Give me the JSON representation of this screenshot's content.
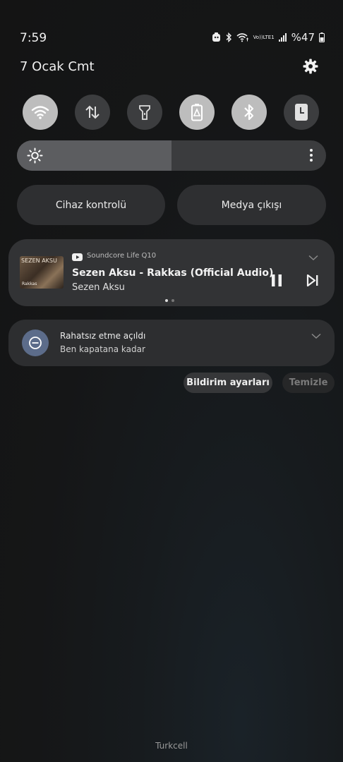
{
  "status_bar": {
    "time": "7:59",
    "volte_top": "Vo))",
    "volte_bottom": "LTE1",
    "battery": "%47"
  },
  "header": {
    "date": "7 Ocak Cmt",
    "settings_icon": "gear-icon"
  },
  "quick_toggles": [
    {
      "name": "wifi",
      "icon": "wifi-icon",
      "on": true
    },
    {
      "name": "mobile-data",
      "icon": "data-arrows-icon",
      "on": false
    },
    {
      "name": "flashlight",
      "icon": "flashlight-icon",
      "on": false
    },
    {
      "name": "power-saving",
      "icon": "power-saving-icon",
      "on": true
    },
    {
      "name": "bluetooth",
      "icon": "bluetooth-icon",
      "on": true
    },
    {
      "name": "screen-timeout",
      "icon": "clock-icon",
      "on": false
    }
  ],
  "brightness": {
    "level": 0.5
  },
  "buttons": {
    "device_control": "Cihaz kontrolü",
    "media_output": "Medya çıkışı"
  },
  "media": {
    "album_text_top": "SEZEN AKSU",
    "album_text_bottom": "Rakkas",
    "source_app": "Soundcore Life Q10",
    "title": "Sezen Aksu - Rakkas (Official Audio)",
    "artist": "Sezen Aksu",
    "page": 1,
    "pages": 2
  },
  "dnd": {
    "title": "Rahatsız etme açıldı",
    "subtitle": "Ben kapatana kadar"
  },
  "actions": {
    "notification_settings": "Bildirim ayarları",
    "clear": "Temizle"
  },
  "carrier": "Turkcell",
  "colors": {
    "toggle_on": "#bdbdbd",
    "toggle_off": "#3c3d3f",
    "dnd_accent": "#5c6c8a"
  }
}
